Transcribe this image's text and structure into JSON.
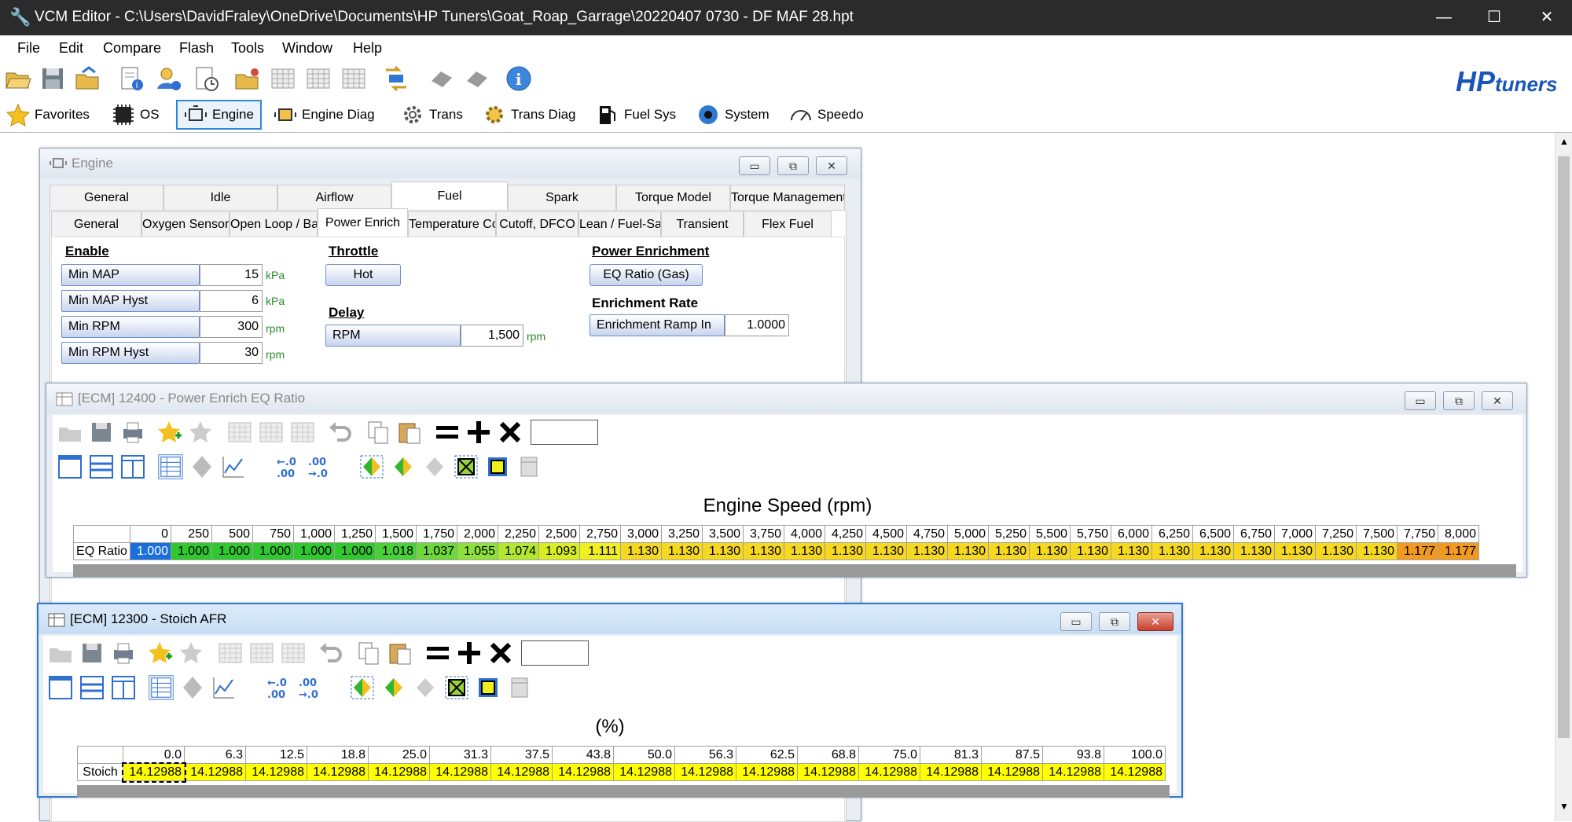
{
  "window": {
    "title": "VCM Editor - C:\\Users\\DavidFraley\\OneDrive\\Documents\\HP Tuners\\Goat_Roap_Garrage\\20220407 0730 - DF MAF 28.hpt"
  },
  "menu": [
    "File",
    "Edit",
    "Compare",
    "Flash",
    "Tools",
    "Window",
    "Help"
  ],
  "brand": {
    "logo_hp": "HP",
    "logo_tuners": "tuners"
  },
  "nav": [
    {
      "label": "Favorites",
      "icon": "star-icon"
    },
    {
      "label": "OS",
      "icon": "chip-icon"
    },
    {
      "label": "Engine",
      "icon": "engine-icon"
    },
    {
      "label": "Engine Diag",
      "icon": "engine-diag-icon"
    },
    {
      "label": "Trans",
      "icon": "gear-icon"
    },
    {
      "label": "Trans Diag",
      "icon": "trans-diag-icon"
    },
    {
      "label": "Fuel Sys",
      "icon": "fuel-pump-icon"
    },
    {
      "label": "System",
      "icon": "system-icon"
    },
    {
      "label": "Speedo",
      "icon": "speedometer-icon"
    }
  ],
  "engine": {
    "title": "Engine",
    "tabs1": [
      "General",
      "Idle",
      "Airflow",
      "Fuel",
      "Spark",
      "Torque Model",
      "Torque Management"
    ],
    "tabs2": [
      "General",
      "Oxygen Sensors",
      "Open Loop / Base",
      "Power Enrich",
      "Temperature Comp",
      "Cutoff, DFCO",
      "Lean / Fuel-Save",
      "Transient",
      "Flex Fuel"
    ],
    "enable": {
      "header": "Enable",
      "rows": [
        {
          "label": "Min MAP",
          "value": "15",
          "unit": "kPa"
        },
        {
          "label": "Min MAP Hyst",
          "value": "6",
          "unit": "kPa"
        },
        {
          "label": "Min RPM",
          "value": "300",
          "unit": "rpm"
        },
        {
          "label": "Min RPM Hyst",
          "value": "30",
          "unit": "rpm"
        }
      ]
    },
    "throttle": {
      "header": "Throttle",
      "button": "Hot"
    },
    "delay": {
      "header": "Delay",
      "label": "RPM",
      "value": "1,500",
      "unit": "rpm"
    },
    "power_enrichment": {
      "header": "Power Enrichment",
      "button": "EQ Ratio (Gas)"
    },
    "enrichment_rate": {
      "header": "Enrichment Rate",
      "label": "Enrichment Ramp In",
      "value": "1.0000"
    }
  },
  "eq_window": {
    "title": "[ECM] 12400 - Power Enrich EQ Ratio",
    "axis_title": "Engine Speed (rpm)",
    "row_label": "EQ Ratio",
    "x": [
      "0",
      "250",
      "500",
      "750",
      "1,000",
      "1,250",
      "1,500",
      "1,750",
      "2,000",
      "2,250",
      "2,500",
      "2,750",
      "3,000",
      "3,250",
      "3,500",
      "3,750",
      "4,000",
      "4,250",
      "4,500",
      "4,750",
      "5,000",
      "5,250",
      "5,500",
      "5,750",
      "6,000",
      "6,250",
      "6,500",
      "6,750",
      "7,000",
      "7,250",
      "7,500",
      "7,750",
      "8,000"
    ],
    "values": [
      "1.000",
      "1.000",
      "1.000",
      "1.000",
      "1.000",
      "1.000",
      "1.018",
      "1.037",
      "1.055",
      "1.074",
      "1.093",
      "1.111",
      "1.130",
      "1.130",
      "1.130",
      "1.130",
      "1.130",
      "1.130",
      "1.130",
      "1.130",
      "1.130",
      "1.130",
      "1.130",
      "1.130",
      "1.130",
      "1.130",
      "1.130",
      "1.130",
      "1.130",
      "1.130",
      "1.130",
      "1.177",
      "1.177"
    ],
    "colors": [
      "#1a6fdc",
      "#2fc82f",
      "#2fc82f",
      "#2fc82f",
      "#2fc82f",
      "#2fc82f",
      "#49d13a",
      "#6cd83a",
      "#8ee03a",
      "#b4e82e",
      "#d8ee22",
      "#f0f020",
      "#f6d820",
      "#f6d820",
      "#f6d820",
      "#f6d820",
      "#f6d820",
      "#f6d820",
      "#f6d820",
      "#f6d820",
      "#f6d820",
      "#f6d820",
      "#f6d820",
      "#f6d820",
      "#f6d820",
      "#f6d820",
      "#f6d820",
      "#f6d820",
      "#f6d820",
      "#f6d820",
      "#f6d820",
      "#f29a20",
      "#f29a20"
    ]
  },
  "afr_window": {
    "title": "[ECM] 12300 - Stoich AFR",
    "axis_title": "(%)",
    "row_label": "Stoich",
    "x": [
      "0.0",
      "6.3",
      "12.5",
      "18.8",
      "25.0",
      "31.3",
      "37.5",
      "43.8",
      "50.0",
      "56.3",
      "62.5",
      "68.8",
      "75.0",
      "81.3",
      "87.5",
      "93.8",
      "100.0"
    ],
    "values": [
      "14.12988",
      "14.12988",
      "14.12988",
      "14.12988",
      "14.12988",
      "14.12988",
      "14.12988",
      "14.12988",
      "14.12988",
      "14.12988",
      "14.12988",
      "14.12988",
      "14.12988",
      "14.12988",
      "14.12988",
      "14.12988",
      "14.12988"
    ],
    "cell_color": "#ffff00"
  }
}
